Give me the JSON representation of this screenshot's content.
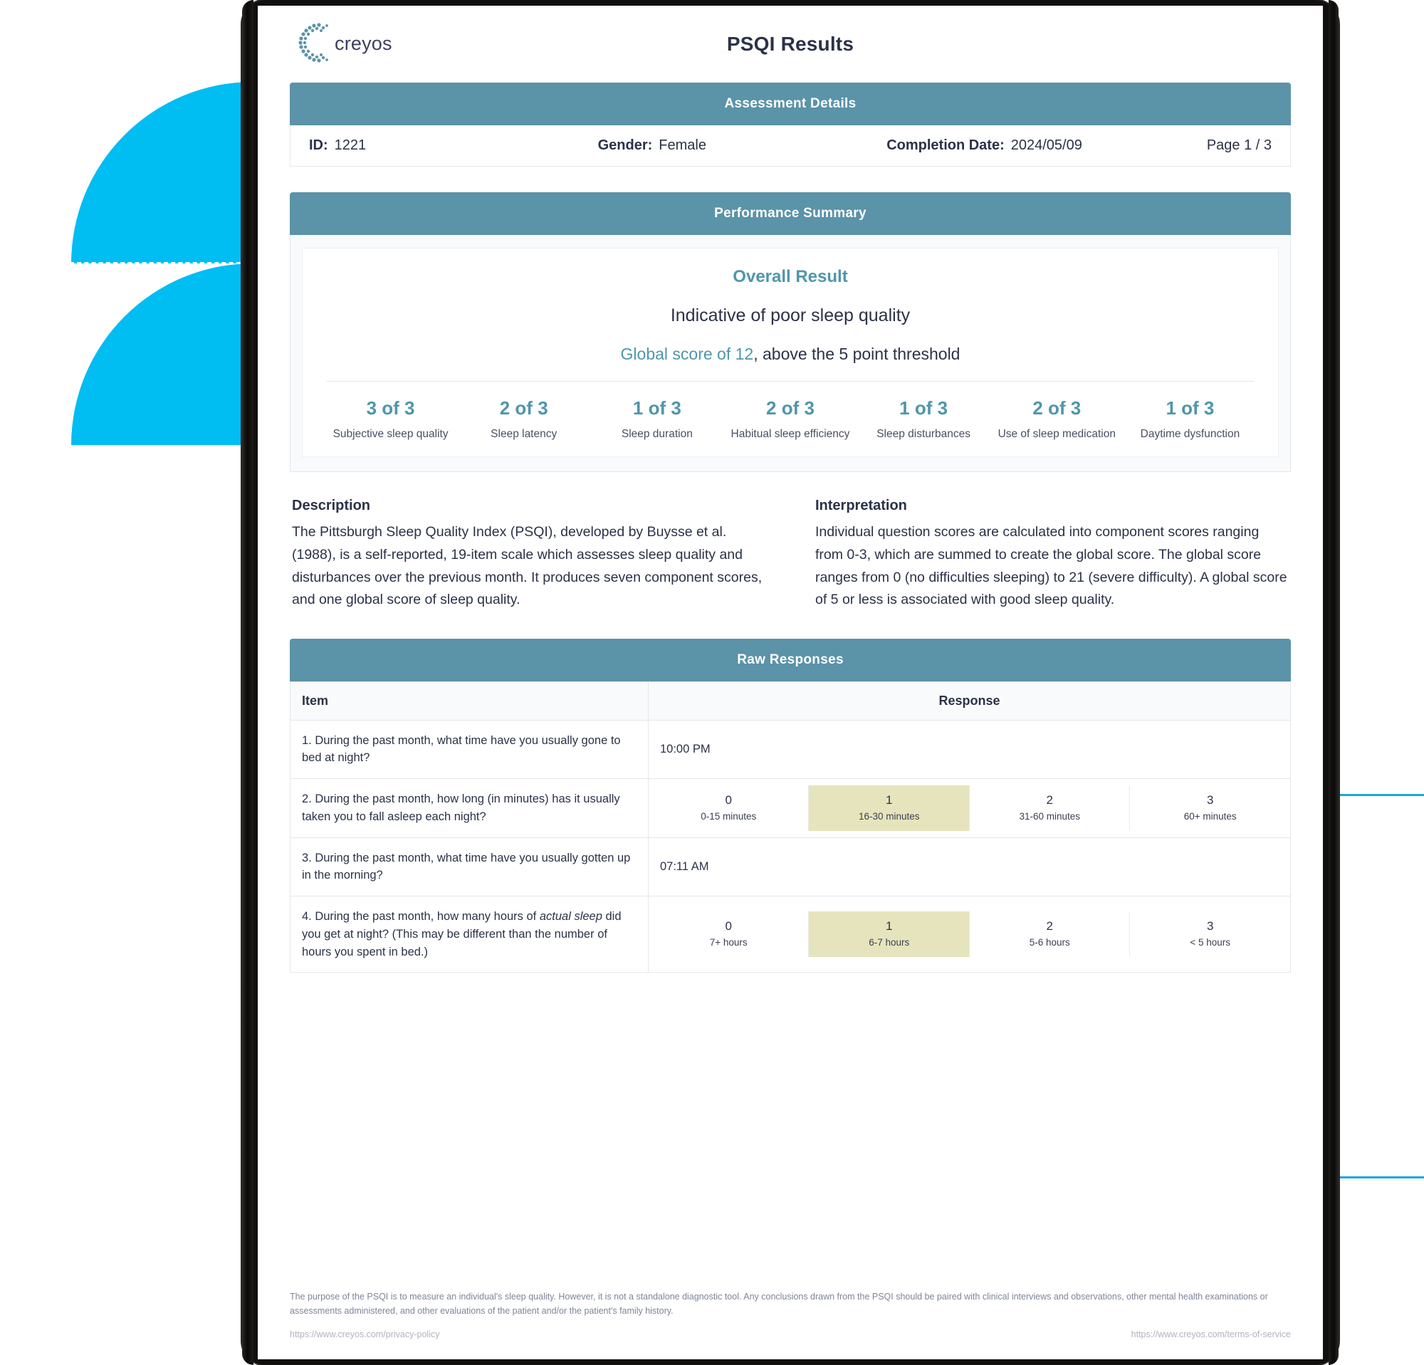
{
  "brand": {
    "name": "creyos",
    "logo_icon": "creyos-dot-c-logo"
  },
  "document": {
    "title": "PSQI Results"
  },
  "assessment_details": {
    "section_title": "Assessment Details",
    "id_label": "ID:",
    "id_value": "1221",
    "gender_label": "Gender:",
    "gender_value": "Female",
    "completion_label": "Completion Date:",
    "completion_value": "2024/05/09",
    "page_indicator": "Page 1 / 3"
  },
  "performance_summary": {
    "section_title": "Performance Summary",
    "overall_label": "Overall Result",
    "overall_result": "Indicative of poor sleep quality",
    "global_score_text": "Global score of 12",
    "global_score_suffix": ", above the 5 point threshold",
    "components": [
      {
        "score": "3 of 3",
        "label": "Subjective sleep quality"
      },
      {
        "score": "2 of 3",
        "label": "Sleep latency"
      },
      {
        "score": "1 of 3",
        "label": "Sleep duration"
      },
      {
        "score": "2 of 3",
        "label": "Habitual sleep efficiency"
      },
      {
        "score": "1 of 3",
        "label": "Sleep disturbances"
      },
      {
        "score": "2 of 3",
        "label": "Use of sleep medication"
      },
      {
        "score": "1 of 3",
        "label": "Daytime dysfunction"
      }
    ]
  },
  "description": {
    "heading": "Description",
    "body": "The Pittsburgh Sleep Quality Index (PSQI), developed by Buysse et al. (1988), is a self-reported, 19-item scale which assesses sleep quality and disturbances over the previous month. It produces seven component scores, and one global score of sleep quality."
  },
  "interpretation": {
    "heading": "Interpretation",
    "body": "Individual question scores are calculated into component scores ranging from 0-3, which are summed to create the global score. The global score ranges from 0 (no difficulties sleeping) to 21 (severe difficulty). A global score of 5 or less is associated with good sleep quality."
  },
  "raw_responses": {
    "section_title": "Raw Responses",
    "col_item": "Item",
    "col_response": "Response",
    "rows": [
      {
        "type": "value",
        "item_prefix": "1. During the past month, what time have you usually gone to bed at night?",
        "item_italic": "",
        "item_suffix": "",
        "value": "10:00 PM"
      },
      {
        "type": "options",
        "item_prefix": "2. During the past month, how long (in minutes) has it usually taken you to fall asleep each night?",
        "item_italic": "",
        "item_suffix": "",
        "options": [
          {
            "num": "0",
            "label": "0-15 minutes",
            "selected": false
          },
          {
            "num": "1",
            "label": "16-30 minutes",
            "selected": true
          },
          {
            "num": "2",
            "label": "31-60 minutes",
            "selected": false
          },
          {
            "num": "3",
            "label": "60+ minutes",
            "selected": false
          }
        ]
      },
      {
        "type": "value",
        "item_prefix": "3. During the past month, what time have you usually gotten up in the morning?",
        "item_italic": "",
        "item_suffix": "",
        "value": "07:11 AM"
      },
      {
        "type": "options",
        "item_prefix": "4. During the past month, how many hours of ",
        "item_italic": "actual sleep",
        "item_suffix": " did you get at night? (This may be different than the number of hours you spent in bed.)",
        "options": [
          {
            "num": "0",
            "label": "7+ hours",
            "selected": false
          },
          {
            "num": "1",
            "label": "6-7 hours",
            "selected": true
          },
          {
            "num": "2",
            "label": "5-6 hours",
            "selected": false
          },
          {
            "num": "3",
            "label": "< 5 hours",
            "selected": false
          }
        ]
      }
    ]
  },
  "footer": {
    "disclaimer": "The purpose of the PSQI is to measure an individual's sleep quality. However, it is not a standalone diagnostic tool. Any conclusions drawn from the PSQI should be paired with clinical interviews and observations, other mental health examinations or assessments administered, and other evaluations of the patient and/or the patient's family history.",
    "privacy_link": "https://www.creyos.com/privacy-policy",
    "terms_link": "https://www.creyos.com/terms-of-service"
  },
  "colors": {
    "section_bar": "#5b93a8",
    "accent_teal": "#4f96ac",
    "text_navy": "#2b3248",
    "selected_option": "#e6e4bc",
    "decor_cyan": "#00bdf2",
    "outline_blue": "#1ba7df"
  }
}
